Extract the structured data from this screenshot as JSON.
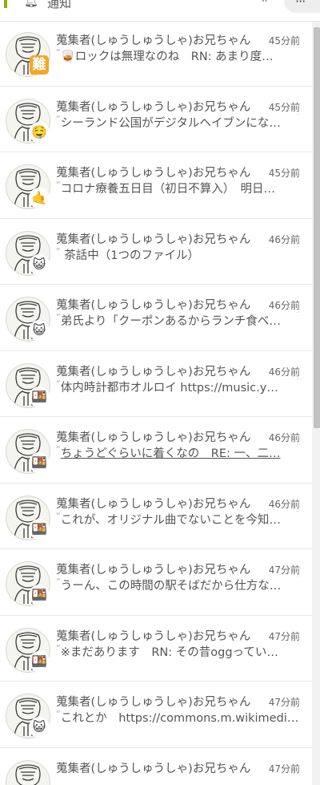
{
  "header": {
    "title": "通知",
    "bell_icon": "bell-icon",
    "grip_icon": "drag-handle-icon",
    "menu_label": "···"
  },
  "items": [
    {
      "name": "蒐集者(しゅうしゅうしゃ)お兄ちゃん",
      "time": "45分前",
      "text": "🥃ロックは無理なのね　RN: あまり度…",
      "reaction": "難",
      "reaction_type": "kanji",
      "underlined": false
    },
    {
      "name": "蒐集者(しゅうしゅうしゃ)お兄ちゃん",
      "time": "45分前",
      "text": "シーランド公国がデジタルヘイブンにな…",
      "reaction": "🤤",
      "reaction_type": "emoji",
      "underlined": false
    },
    {
      "name": "蒐集者(しゅうしゅうしゃ)お兄ちゃん",
      "time": "45分前",
      "text": "コロナ療養五日目（初日不算入）　明日…",
      "reaction": "🤙",
      "reaction_type": "emoji",
      "underlined": false
    },
    {
      "name": "蒐集者(しゅうしゅうしゃ)お兄ちゃん",
      "time": "46分前",
      "text": " 茶話中（1つのファイル）",
      "reaction": "😺",
      "reaction_type": "emoji",
      "underlined": false
    },
    {
      "name": "蒐集者(しゅうしゅうしゃ)お兄ちゃん",
      "time": "46分前",
      "text": "弟氏より「クーポンあるからランチ食べ…",
      "reaction": "😺",
      "reaction_type": "emoji",
      "underlined": false
    },
    {
      "name": "蒐集者(しゅうしゅうしゃ)お兄ちゃん",
      "time": "46分前",
      "text": "体内時計都市オルロイ https://music.y…",
      "reaction": "🍱",
      "reaction_type": "emoji",
      "underlined": false
    },
    {
      "name": "蒐集者(しゅうしゅうしゃ)お兄ちゃん",
      "time": "46分前",
      "text": "ちょうどぐらいに着くなの　RE: 一、二…",
      "reaction": "🍱",
      "reaction_type": "emoji",
      "underlined": true
    },
    {
      "name": "蒐集者(しゅうしゅうしゃ)お兄ちゃん",
      "time": "46分前",
      "text": "これが、オリジナル曲でないことを今知…",
      "reaction": "🍱",
      "reaction_type": "emoji",
      "underlined": false
    },
    {
      "name": "蒐集者(しゅうしゅうしゃ)お兄ちゃん",
      "time": "47分前",
      "text": "うーん、この時間の駅そばだから仕方な…",
      "reaction": "🍱",
      "reaction_type": "emoji",
      "underlined": false
    },
    {
      "name": "蒐集者(しゅうしゅうしゃ)お兄ちゃん",
      "time": "47分前",
      "text": "※まだあります　RN: その昔oggってい…",
      "reaction": "🍱",
      "reaction_type": "emoji",
      "underlined": false
    },
    {
      "name": "蒐集者(しゅうしゅうしゃ)お兄ちゃん",
      "time": "47分前",
      "text": "これとか　https://commons.m.wikimedi…",
      "reaction": "😺",
      "reaction_type": "emoji",
      "underlined": false
    },
    {
      "name": "蒐集者(しゅうしゅうしゃ)お兄ちゃん",
      "time": "47分前",
      "text": "",
      "reaction": "",
      "reaction_type": "emoji",
      "underlined": false
    }
  ],
  "quote_open": "“",
  "quote_close": "”",
  "colors": {
    "accent": "#86b300",
    "text": "#555555",
    "divider": "#e8e8e8"
  }
}
